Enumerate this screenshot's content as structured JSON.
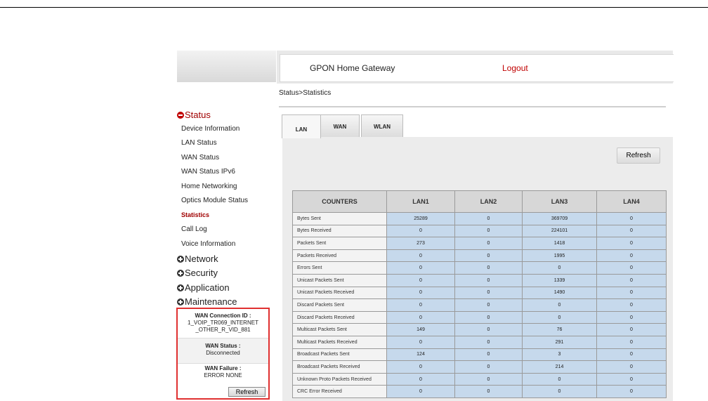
{
  "header": {
    "title": "GPON Home Gateway",
    "logout": "Logout"
  },
  "breadcrumb": "Status>Statistics",
  "sidebar": {
    "sections": [
      {
        "label": "Status",
        "expanded": true
      },
      {
        "label": "Network",
        "expanded": false
      },
      {
        "label": "Security",
        "expanded": false
      },
      {
        "label": "Application",
        "expanded": false
      },
      {
        "label": "Maintenance",
        "expanded": false
      }
    ],
    "status_items": [
      "Device Information",
      "LAN Status",
      "WAN Status",
      "WAN Status IPv6",
      "Home Networking",
      "Optics Module Status",
      "Statistics",
      "Call Log",
      "Voice Information"
    ],
    "active_item": "Statistics"
  },
  "wan_box": {
    "conn_id_label": "WAN Connection ID :",
    "conn_id_line1": "1_VOIP_TR069_INTERNET",
    "conn_id_line2": "_OTHER_R_VID_881",
    "status_label": "WAN Status :",
    "status_value": "Disconnected",
    "failure_label": "WAN Failure :",
    "failure_value": "ERROR NONE",
    "refresh": "Refresh"
  },
  "tabs": [
    {
      "label": "LAN",
      "active": true
    },
    {
      "label": "WAN",
      "active": false
    },
    {
      "label": "WLAN",
      "active": false
    }
  ],
  "panel_refresh": "Refresh",
  "table": {
    "columns": [
      "COUNTERS",
      "LAN1",
      "LAN2",
      "LAN3",
      "LAN4"
    ],
    "rows": [
      [
        "Bytes Sent",
        "25289",
        "0",
        "369709",
        "0"
      ],
      [
        "Bytes Received",
        "0",
        "0",
        "224101",
        "0"
      ],
      [
        "Packets Sent",
        "273",
        "0",
        "1418",
        "0"
      ],
      [
        "Packets Received",
        "0",
        "0",
        "1995",
        "0"
      ],
      [
        "Errors Sent",
        "0",
        "0",
        "0",
        "0"
      ],
      [
        "Unicast Packets Sent",
        "0",
        "0",
        "1339",
        "0"
      ],
      [
        "Unicast Packets Received",
        "0",
        "0",
        "1490",
        "0"
      ],
      [
        "Discard Packets Sent",
        "0",
        "0",
        "0",
        "0"
      ],
      [
        "Discard Packets Received",
        "0",
        "0",
        "0",
        "0"
      ],
      [
        "Multicast Packets Sent",
        "149",
        "0",
        "76",
        "0"
      ],
      [
        "Multicast Packets Received",
        "0",
        "0",
        "291",
        "0"
      ],
      [
        "Broadcast Packets Sent",
        "124",
        "0",
        "3",
        "0"
      ],
      [
        "Broadcast Packets Received",
        "0",
        "0",
        "214",
        "0"
      ],
      [
        "Unknown Proto Packets Received",
        "0",
        "0",
        "0",
        "0"
      ],
      [
        "CRC Error Received",
        "0",
        "0",
        "0",
        "0"
      ]
    ]
  },
  "colors": {
    "accent_red": "#c00000",
    "cell_blue": "#c6d9ec",
    "highlight_border": "#e03030"
  }
}
